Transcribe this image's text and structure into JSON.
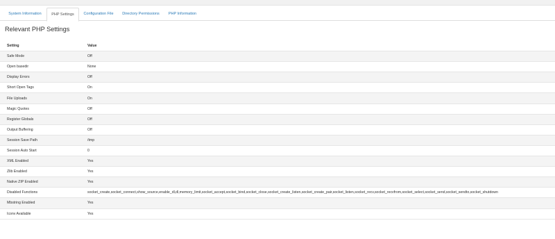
{
  "tabs": [
    {
      "label": "System Information",
      "active": false
    },
    {
      "label": "PHP Settings",
      "active": true
    },
    {
      "label": "Configuration File",
      "active": false
    },
    {
      "label": "Directory Permissions",
      "active": false
    },
    {
      "label": "PHP Information",
      "active": false
    }
  ],
  "page": {
    "title": "Relevant PHP Settings"
  },
  "table": {
    "headers": [
      "Setting",
      "Value"
    ],
    "rows": [
      {
        "setting": "Safe Mode",
        "value": "Off"
      },
      {
        "setting": "Open basedir",
        "value": "None"
      },
      {
        "setting": "Display Errors",
        "value": "Off"
      },
      {
        "setting": "Short Open Tags",
        "value": "On"
      },
      {
        "setting": "File Uploads",
        "value": "On"
      },
      {
        "setting": "Magic Quotes",
        "value": "Off"
      },
      {
        "setting": "Register Globals",
        "value": "Off"
      },
      {
        "setting": "Output Buffering",
        "value": "Off"
      },
      {
        "setting": "Session Save Path",
        "value": "/tmp"
      },
      {
        "setting": "Session Auto Start",
        "value": "0"
      },
      {
        "setting": "XML Enabled",
        "value": "Yes"
      },
      {
        "setting": "Zlib Enabled",
        "value": "Yes"
      },
      {
        "setting": "Native ZIP Enabled",
        "value": "Yes"
      },
      {
        "setting": "Disabled Functions",
        "value": "socket_create,socket_connect,show_source,enable_dl,dl,memory_limit,socket_accept,socket_bind,socket_close,socket_create_listen,socket_create_pair,socket_listen,socket_recv,socket_recvfrom,socket_select,socket_send,socket_sendto,socket_shutdown"
      },
      {
        "setting": "Mbstring Enabled",
        "value": "Yes"
      },
      {
        "setting": "Iconv Available",
        "value": "Yes"
      }
    ]
  }
}
